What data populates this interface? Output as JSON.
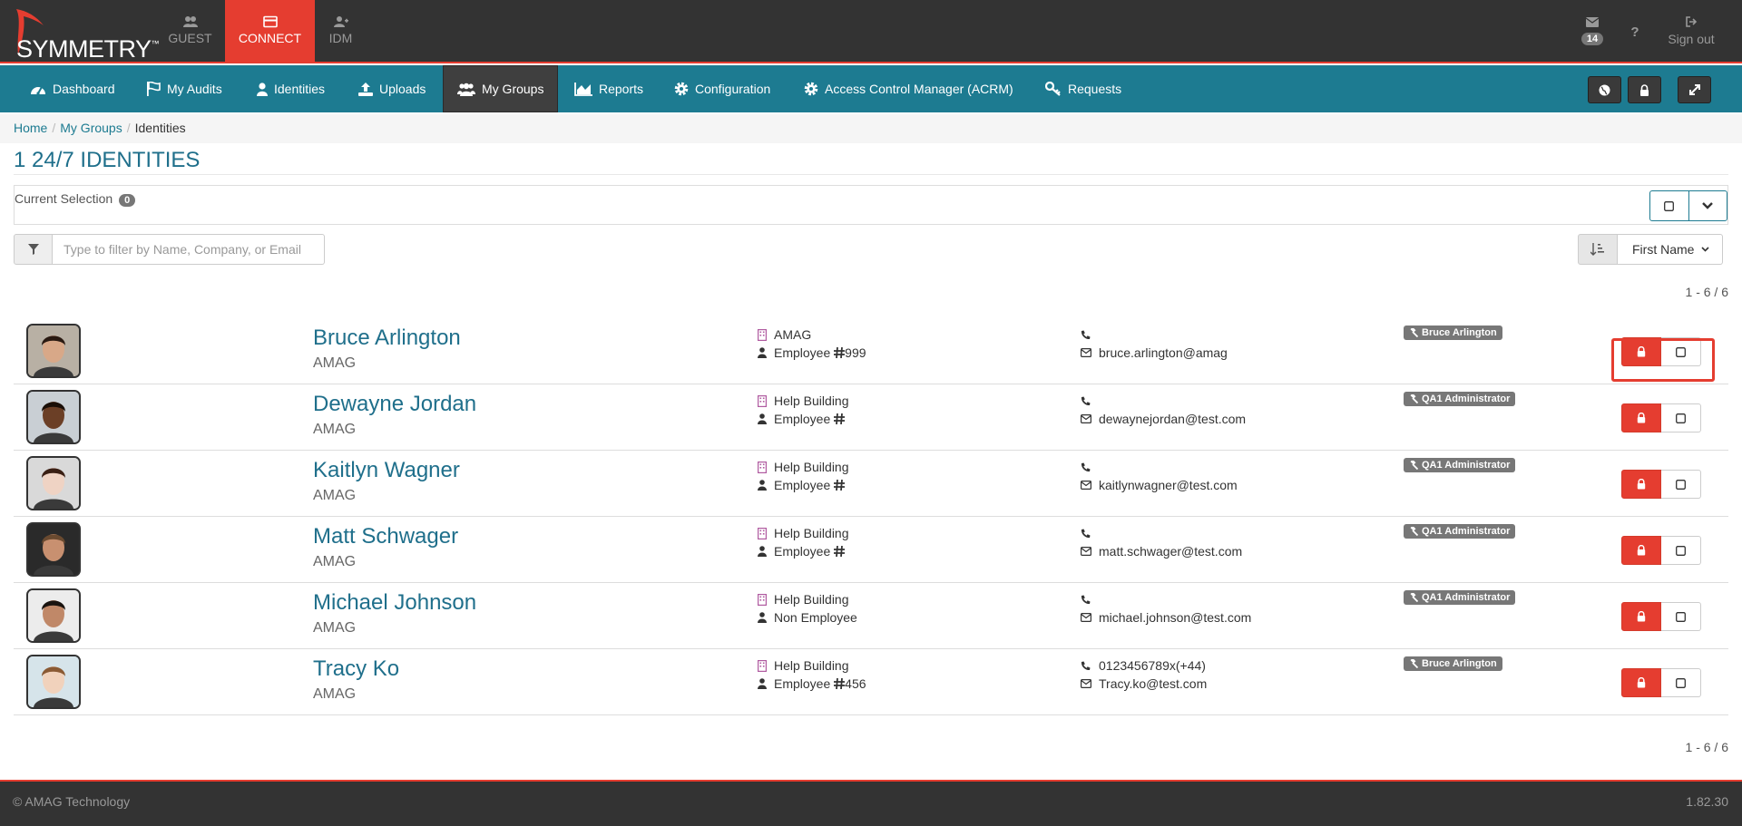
{
  "brand": {
    "name": "SYMMETRY",
    "tm": "™"
  },
  "app_tabs": [
    {
      "label": "GUEST",
      "icon": "users-icon"
    },
    {
      "label": "CONNECT",
      "icon": "card-icon"
    },
    {
      "label": "IDM",
      "icon": "user-plus-icon"
    }
  ],
  "top_right": {
    "message_count": "14",
    "help_label": "?",
    "sign_out_label": "Sign out"
  },
  "nav": [
    {
      "label": "Dashboard",
      "icon": "dashboard-icon"
    },
    {
      "label": "My Audits",
      "icon": "flag-icon"
    },
    {
      "label": "Identities",
      "icon": "user-icon"
    },
    {
      "label": "Uploads",
      "icon": "upload-icon"
    },
    {
      "label": "My Groups",
      "icon": "users-icon"
    },
    {
      "label": "Reports",
      "icon": "area-chart-icon"
    },
    {
      "label": "Configuration",
      "icon": "gear-icon"
    },
    {
      "label": "Access Control Manager (ACRM)",
      "icon": "gear-icon"
    },
    {
      "label": "Requests",
      "icon": "key-icon"
    }
  ],
  "breadcrumb": [
    "Home",
    "My Groups",
    "Identities"
  ],
  "page_title": "1 24/7 IDENTITIES",
  "selection": {
    "label": "Current Selection",
    "count": "0"
  },
  "filter": {
    "placeholder": "Type to filter by Name, Company, or Email"
  },
  "sort": {
    "selected": "First Name"
  },
  "pager": {
    "top": "1 - 6 / 6",
    "bottom": "1 - 6 / 6"
  },
  "employee_label": "Employee",
  "rows": [
    {
      "name": "Bruce Arlington",
      "company": "AMAG",
      "location": "AMAG",
      "type": "Employee",
      "emp_no": "999",
      "phone": "",
      "email": "bruce.arlington@amag",
      "role": "Bruce Arlington",
      "avatar_skin": "#d8a888",
      "avatar_hair": "#2a1a12",
      "avatar_bg": "#b8b0a4"
    },
    {
      "name": "Dewayne Jordan",
      "company": "AMAG",
      "location": "Help Building",
      "type": "Employee",
      "emp_no": "",
      "phone": "",
      "email": "dewaynejordan@test.com",
      "role": "QA1 Administrator",
      "avatar_skin": "#6b3f26",
      "avatar_hair": "#1a0f08",
      "avatar_bg": "#c9cfd4"
    },
    {
      "name": "Kaitlyn Wagner",
      "company": "AMAG",
      "location": "Help Building",
      "type": "Employee",
      "emp_no": "",
      "phone": "",
      "email": "kaitlynwagner@test.com",
      "role": "QA1 Administrator",
      "avatar_skin": "#efd3c4",
      "avatar_hair": "#3a1f14",
      "avatar_bg": "#d9d9d9"
    },
    {
      "name": "Matt Schwager",
      "company": "AMAG",
      "location": "Help Building",
      "type": "Employee",
      "emp_no": "",
      "phone": "",
      "email": "matt.schwager@test.com",
      "role": "QA1 Administrator",
      "avatar_skin": "#c89070",
      "avatar_hair": "#6a4a30",
      "avatar_bg": "#2a2a2a"
    },
    {
      "name": "Michael Johnson",
      "company": "AMAG",
      "location": "Help Building",
      "type": "Non Employee",
      "emp_no": "",
      "phone": "",
      "email": "michael.johnson@test.com",
      "role": "QA1 Administrator",
      "avatar_skin": "#c08868",
      "avatar_hair": "#1a1410",
      "avatar_bg": "#ececec"
    },
    {
      "name": "Tracy Ko",
      "company": "AMAG",
      "location": "Help Building",
      "type": "Employee",
      "emp_no": "456",
      "phone": "0123456789x(+44)",
      "email": "Tracy.ko@test.com",
      "role": "Bruce Arlington",
      "avatar_skin": "#f1d2bc",
      "avatar_hair": "#8a5a34",
      "avatar_bg": "#d6e4ea"
    }
  ],
  "footer": {
    "copyright": "© AMAG Technology",
    "version": "1.82.30"
  },
  "colors": {
    "accent_red": "#e53d30",
    "nav_teal": "#1d7b91",
    "title_blue": "#1f6f8b",
    "dark_bar": "#333333"
  }
}
